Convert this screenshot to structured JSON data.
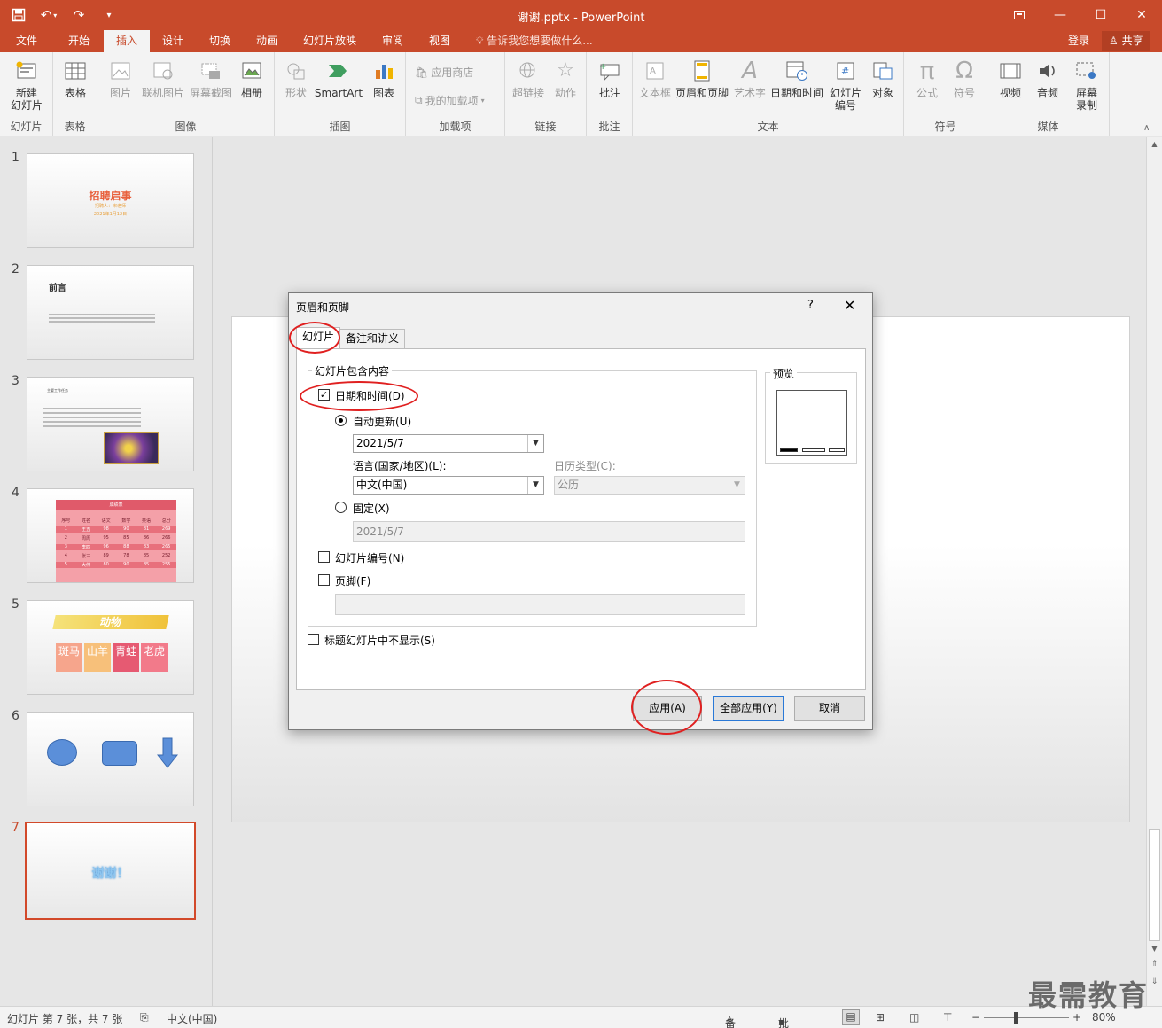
{
  "window": {
    "title": "谢谢.pptx - PowerPoint"
  },
  "tabs": [
    "文件",
    "开始",
    "插入",
    "设计",
    "切换",
    "动画",
    "幻灯片放映",
    "审阅",
    "视图"
  ],
  "tell_me": "告诉我您想要做什么...",
  "account": {
    "login": "登录",
    "share": "共享"
  },
  "ribbon": {
    "slides": {
      "new_slide": "新建\n幻灯片",
      "label": "幻灯片"
    },
    "tables": {
      "table": "表格",
      "label": "表格"
    },
    "images": {
      "picture": "图片",
      "online": "联机图片",
      "screenshot": "屏幕截图",
      "album": "相册",
      "label": "图像"
    },
    "illustrations": {
      "shapes": "形状",
      "smartart": "SmartArt",
      "chart": "图表",
      "label": "插图"
    },
    "addins": {
      "store": "应用商店",
      "my": "我的加载项",
      "label": "加载项"
    },
    "links": {
      "hyperlink": "超链接",
      "action": "动作",
      "label": "链接"
    },
    "comments": {
      "comment": "批注",
      "label": "批注"
    },
    "text": {
      "textbox": "文本框",
      "header_footer": "页眉和页脚",
      "wordart": "艺术字",
      "datetime": "日期和时间",
      "slide_number": "幻灯片\n编号",
      "object": "对象",
      "label": "文本"
    },
    "symbols": {
      "equation": "公式",
      "symbol": "符号",
      "label": "符号"
    },
    "media": {
      "video": "视频",
      "audio": "音频",
      "record": "屏幕\n录制",
      "label": "媒体"
    }
  },
  "thumbnails": [
    {
      "num": "1",
      "title": "招聘启事",
      "sub1": "招聘人：宋老师",
      "sub2": "2021年1月12日"
    },
    {
      "num": "2",
      "title": "前言"
    },
    {
      "num": "3",
      "title": "主要工作任务"
    },
    {
      "num": "4",
      "title": "成绩表",
      "headers": [
        "序号",
        "姓名",
        "语文",
        "数学",
        "英语",
        "总分"
      ],
      "rows": [
        [
          "1",
          "王五",
          "98",
          "90",
          "81",
          "269"
        ],
        [
          "2",
          "周周",
          "95",
          "85",
          "86",
          "266"
        ],
        [
          "3",
          "李四",
          "96",
          "88",
          "83",
          "265"
        ],
        [
          "4",
          "张三",
          "89",
          "78",
          "85",
          "252"
        ],
        [
          "5",
          "大伟",
          "80",
          "90",
          "85",
          "255"
        ]
      ]
    },
    {
      "num": "5",
      "title": "动物",
      "cells": [
        "斑马",
        "山羊",
        "青蛙",
        "老虎"
      ]
    },
    {
      "num": "6"
    },
    {
      "num": "7",
      "title": "谢谢！"
    }
  ],
  "dialog": {
    "title": "页眉和页脚",
    "help": "?",
    "close": "✕",
    "tab_slide": "幻灯片",
    "tab_notes": "备注和讲义",
    "group_label": "幻灯片包含内容",
    "datetime_label": "日期和时间(D)",
    "datetime_checked": true,
    "auto_update_label": "自动更新(U)",
    "auto_update_value": "2021/5/7",
    "language_label": "语言(国家/地区)(L):",
    "language_value": "中文(中国)",
    "calendar_label": "日历类型(C):",
    "calendar_value": "公历",
    "fixed_label": "固定(X)",
    "fixed_value": "2021/5/7",
    "slide_number_label": "幻灯片编号(N)",
    "footer_label": "页脚(F)",
    "footer_value": "",
    "no_title_label": "标题幻灯片中不显示(S)",
    "preview_label": "预览",
    "btn_apply": "应用(A)",
    "btn_apply_all": "全部应用(Y)",
    "btn_cancel": "取消"
  },
  "status": {
    "slide_info": "幻灯片 第 7 张，共 7 张",
    "language": "中文(中国)",
    "notes": "备注",
    "comments": "批注",
    "zoom": "80%"
  },
  "watermark": "最需教育",
  "colors": {
    "accent": "#c84a2b",
    "annotation_ring": "#e02020",
    "default_button": "#2a79d7"
  }
}
